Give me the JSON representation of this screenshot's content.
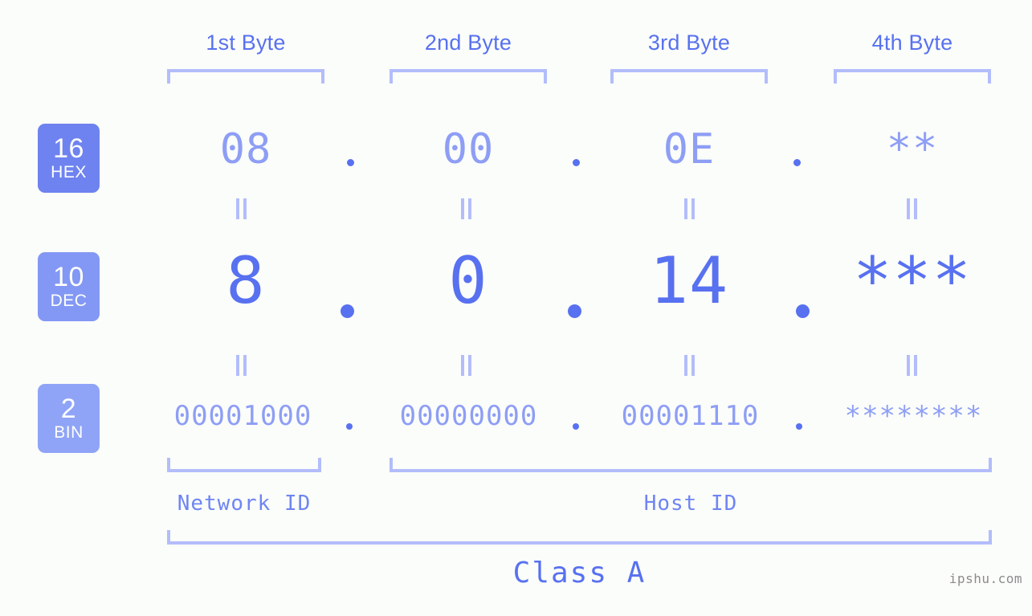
{
  "theme": {
    "background": "#fbfdfa",
    "accent_strong": "#5871f0",
    "accent_mid": "#8e9ef5",
    "accent_light": "#b3bdfb",
    "badge_hex": "#6e83ef",
    "badge_dec": "#8398f4",
    "badge_bin": "#8fa4f7",
    "watermark_color": "#8c8c8c"
  },
  "headers": [
    {
      "label": "1st Byte"
    },
    {
      "label": "2nd Byte"
    },
    {
      "label": "3rd Byte"
    },
    {
      "label": "4th Byte"
    }
  ],
  "rows": [
    {
      "id": "hex",
      "badge_number": "16",
      "badge_label": "HEX",
      "values": [
        "08",
        "00",
        "0E",
        "**"
      ],
      "separator": "."
    },
    {
      "id": "dec",
      "badge_number": "10",
      "badge_label": "DEC",
      "values": [
        "8",
        "0",
        "14",
        "***"
      ],
      "separator": "."
    },
    {
      "id": "bin",
      "badge_number": "2",
      "badge_label": "BIN",
      "values": [
        "00001000",
        "00000000",
        "00001110",
        "********"
      ],
      "separator": "."
    }
  ],
  "equivalence_mark": "=",
  "sections": [
    {
      "label": "Network ID"
    },
    {
      "label": "Host ID"
    }
  ],
  "class_label": "Class A",
  "watermark": "ipshu.com"
}
